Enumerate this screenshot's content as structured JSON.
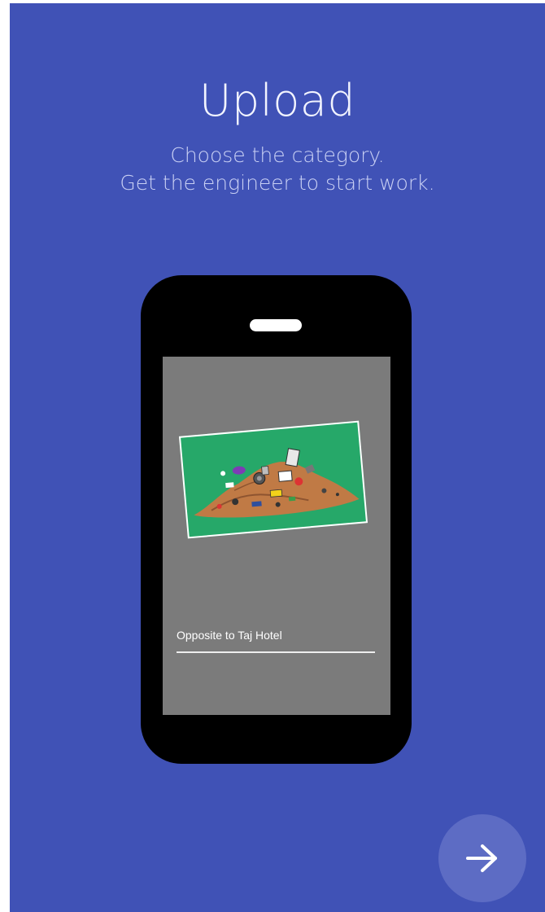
{
  "onboarding": {
    "title": "Upload",
    "subtitle_line1": "Choose the category.",
    "subtitle_line2": "Get the engineer to start work."
  },
  "illustration": {
    "photo": "garbage-pile-illustration",
    "location_field_value": "Opposite to Taj Hotel"
  },
  "navigation": {
    "next_icon": "arrow-right-icon"
  },
  "colors": {
    "background": "#4052b6",
    "phone_body": "#000000",
    "phone_screen": "#7b7b7b",
    "photo_background": "#26a869",
    "next_button": "#5d6cc4"
  }
}
